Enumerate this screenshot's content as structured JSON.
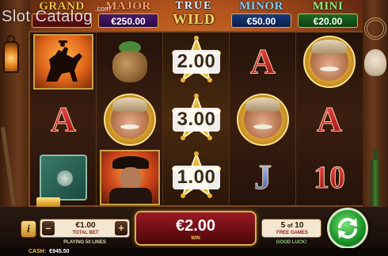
{
  "watermark": {
    "text": "Slot Catalog",
    "com": ".com"
  },
  "jackpots": {
    "grand": {
      "title": "GRAND",
      "value": ""
    },
    "major": {
      "title": "MAJOR",
      "value": "€250.00"
    },
    "minor": {
      "title": "MINOR",
      "value": "€50.00"
    },
    "mini": {
      "title": "MINI",
      "value": "€20.00"
    }
  },
  "logo": {
    "line1": "TRUE",
    "line2": "WILD"
  },
  "reels": [
    {
      "symbols": [
        "horse-rider",
        "letter-A",
        "safe-gold"
      ]
    },
    {
      "symbols": [
        "money-bag",
        "cowboy-badge",
        "outlaw"
      ]
    },
    {
      "symbols": [
        "2.00",
        "3.00",
        "1.00"
      ],
      "wild": true
    },
    {
      "symbols": [
        "letter-A",
        "cowboy-badge",
        "letter-J"
      ]
    },
    {
      "symbols": [
        "cowboy-badge",
        "letter-A",
        "number-10"
      ]
    }
  ],
  "symbol_text": {
    "letter_a": "A",
    "letter_j": "J",
    "number_10": "10",
    "wild_mult_1": "2.00",
    "wild_mult_2": "3.00",
    "wild_mult_3": "1.00"
  },
  "controls": {
    "info_label": "i",
    "bet_minus": "–",
    "bet_plus": "+",
    "bet_value": "€1.00",
    "bet_label": "TOTAL BET",
    "lines_text": "PLAYING 50 LINES",
    "win_value": "€2.00",
    "win_label": "WIN",
    "free_current": "5",
    "free_of": "of",
    "free_total": "10",
    "free_label": "FREE GAMES",
    "luck_text": "GOOD LUCK!"
  },
  "cash": {
    "label": "CASH:",
    "value": "€945.50"
  },
  "colors": {
    "accent_gold": "#f6c94a",
    "win_red": "#9a1a24",
    "spin_green": "#1e9a2a"
  }
}
